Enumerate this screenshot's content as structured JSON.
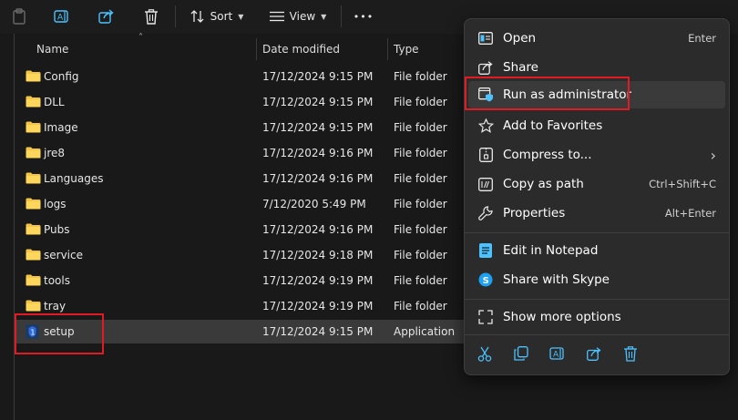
{
  "toolbar": {
    "sort_label": "Sort",
    "view_label": "View",
    "more_label": "•••"
  },
  "columns": {
    "name": "Name",
    "date": "Date modified",
    "type": "Type"
  },
  "files": [
    {
      "name": "Config",
      "date": "17/12/2024 9:15 PM",
      "type": "File folder"
    },
    {
      "name": "DLL",
      "date": "17/12/2024 9:15 PM",
      "type": "File folder"
    },
    {
      "name": "Image",
      "date": "17/12/2024 9:15 PM",
      "type": "File folder"
    },
    {
      "name": "jre8",
      "date": "17/12/2024 9:16 PM",
      "type": "File folder"
    },
    {
      "name": "Languages",
      "date": "17/12/2024 9:16 PM",
      "type": "File folder"
    },
    {
      "name": "logs",
      "date": "7/12/2020 5:49 PM",
      "type": "File folder"
    },
    {
      "name": "Pubs",
      "date": "17/12/2024 9:16 PM",
      "type": "File folder"
    },
    {
      "name": "service",
      "date": "17/12/2024 9:18 PM",
      "type": "File folder"
    },
    {
      "name": "tools",
      "date": "17/12/2024 9:19 PM",
      "type": "File folder"
    },
    {
      "name": "tray",
      "date": "17/12/2024 9:19 PM",
      "type": "File folder"
    },
    {
      "name": "setup",
      "date": "17/12/2024 9:15 PM",
      "type": "Application"
    }
  ],
  "context_menu": {
    "open": {
      "label": "Open",
      "shortcut": "Enter"
    },
    "share": {
      "label": "Share"
    },
    "run_as_admin": {
      "label": "Run as administrator"
    },
    "add_favorites": {
      "label": "Add to Favorites"
    },
    "compress": {
      "label": "Compress to...",
      "submenu_arrow": "›"
    },
    "copy_path": {
      "label": "Copy as path",
      "shortcut": "Ctrl+Shift+C"
    },
    "properties": {
      "label": "Properties",
      "shortcut": "Alt+Enter"
    },
    "edit_notepad": {
      "label": "Edit in Notepad"
    },
    "share_skype": {
      "label": "Share with Skype"
    },
    "show_more": {
      "label": "Show more options"
    }
  },
  "colors": {
    "background": "#191919",
    "menu_background": "#2b2b2b",
    "selection": "#3a3a3a",
    "highlight_box": "#e01b24",
    "folder": "#f4c542",
    "accent": "#4cc2ff"
  }
}
